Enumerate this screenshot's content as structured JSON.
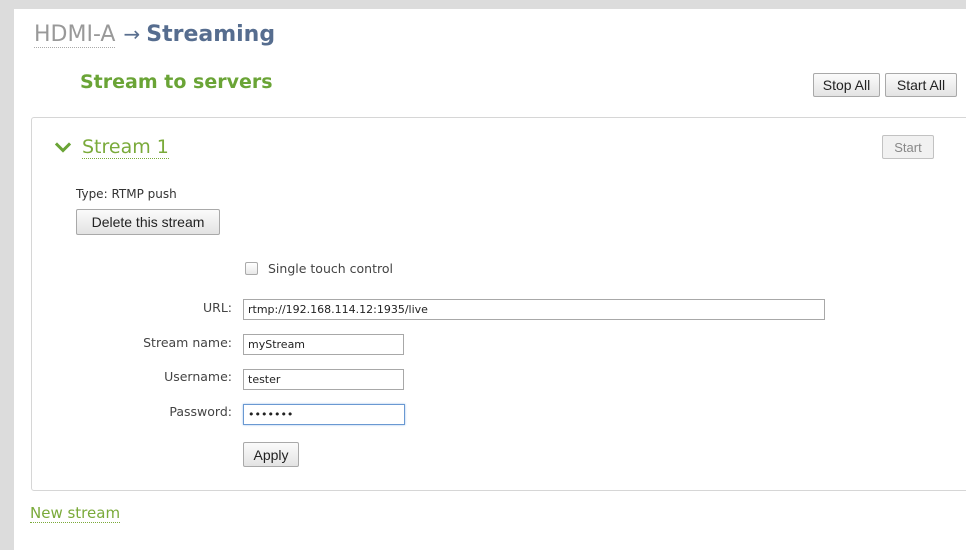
{
  "breadcrumb": {
    "parent": "HDMI-A",
    "arrow": "→",
    "current": "Streaming"
  },
  "section": {
    "heading": "Stream to servers",
    "stop_all_label": "Stop All",
    "start_all_label": "Start All"
  },
  "stream": {
    "title": "Stream 1",
    "start_label": "Start",
    "type_label": "Type:",
    "type_value": "RTMP push",
    "delete_label": "Delete this stream",
    "single_touch_label": "Single touch control",
    "single_touch_checked": false,
    "fields": {
      "url_label": "URL:",
      "url_value": "rtmp://192.168.114.12:1935/live",
      "stream_name_label": "Stream name:",
      "stream_name_value": "myStream",
      "username_label": "Username:",
      "username_value": "tester",
      "password_label": "Password:",
      "password_value": "•••••••"
    },
    "apply_label": "Apply"
  },
  "new_stream_label": "New stream",
  "colors": {
    "accent_green": "#6aa436",
    "title_blue": "#566d8f",
    "link_green": "#7aaa3a"
  },
  "icons": {
    "expand": "chevron-down-icon"
  }
}
